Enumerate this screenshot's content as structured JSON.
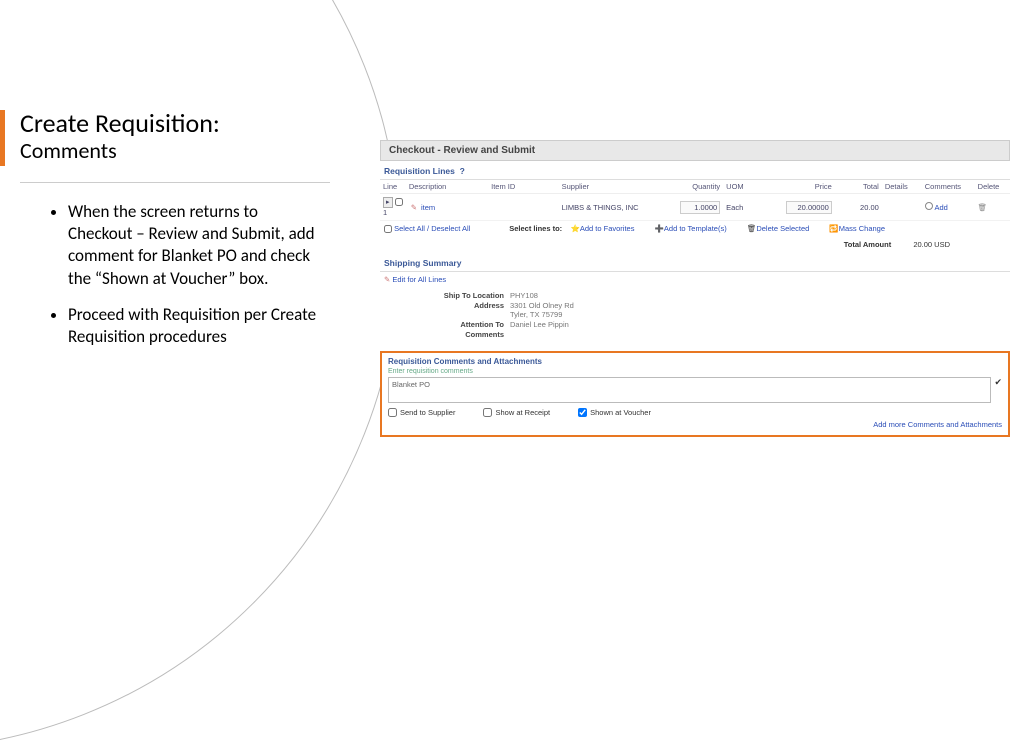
{
  "slide": {
    "title": "Create Requisition:",
    "subtitle": "Comments",
    "bullets": [
      "When the screen returns to Checkout – Review and Submit, add comment for Blanket PO and check the “Shown at Voucher” box.",
      "Proceed with Requisition per Create Requisition procedures"
    ]
  },
  "shot": {
    "header": "Checkout - Review and Submit",
    "req_lines_title": "Requisition Lines",
    "cols": {
      "line": "Line",
      "desc": "Description",
      "item": "Item ID",
      "supplier": "Supplier",
      "qty": "Quantity",
      "uom": "UOM",
      "price": "Price",
      "total": "Total",
      "details": "Details",
      "comments": "Comments",
      "delete": "Delete"
    },
    "row": {
      "line": "1",
      "desc": "item",
      "supplier": "LIMBS & THINGS, INC",
      "qty": "1.0000",
      "uom": "Each",
      "price": "20.00000",
      "total": "20.00",
      "add": "Add"
    },
    "actions": {
      "select_all": "Select All / Deselect All",
      "select_lines": "Select lines to:",
      "fav": "Add to Favorites",
      "tmpl": "Add to Template(s)",
      "del": "Delete Selected",
      "mass": "Mass Change"
    },
    "total_label": "Total Amount",
    "total_value": "20.00 USD",
    "ship_title": "Shipping Summary",
    "edit_all": "Edit for All Lines",
    "ship": {
      "loc_lbl": "Ship To Location",
      "loc": "PHY108",
      "addr_lbl": "Address",
      "addr1": "3301 Old Olney Rd",
      "addr2": "Tyler, TX 75799",
      "attn_lbl": "Attention To",
      "attn": "Daniel Lee Pippin",
      "com_lbl": "Comments"
    },
    "comments": {
      "title": "Requisition Comments and Attachments",
      "enter": "Enter requisition comments",
      "text": "Blanket PO",
      "cb_supplier": "Send to Supplier",
      "cb_receipt": "Show at Receipt",
      "cb_voucher": "Shown at Voucher",
      "addmore": "Add more Comments and Attachments"
    }
  }
}
